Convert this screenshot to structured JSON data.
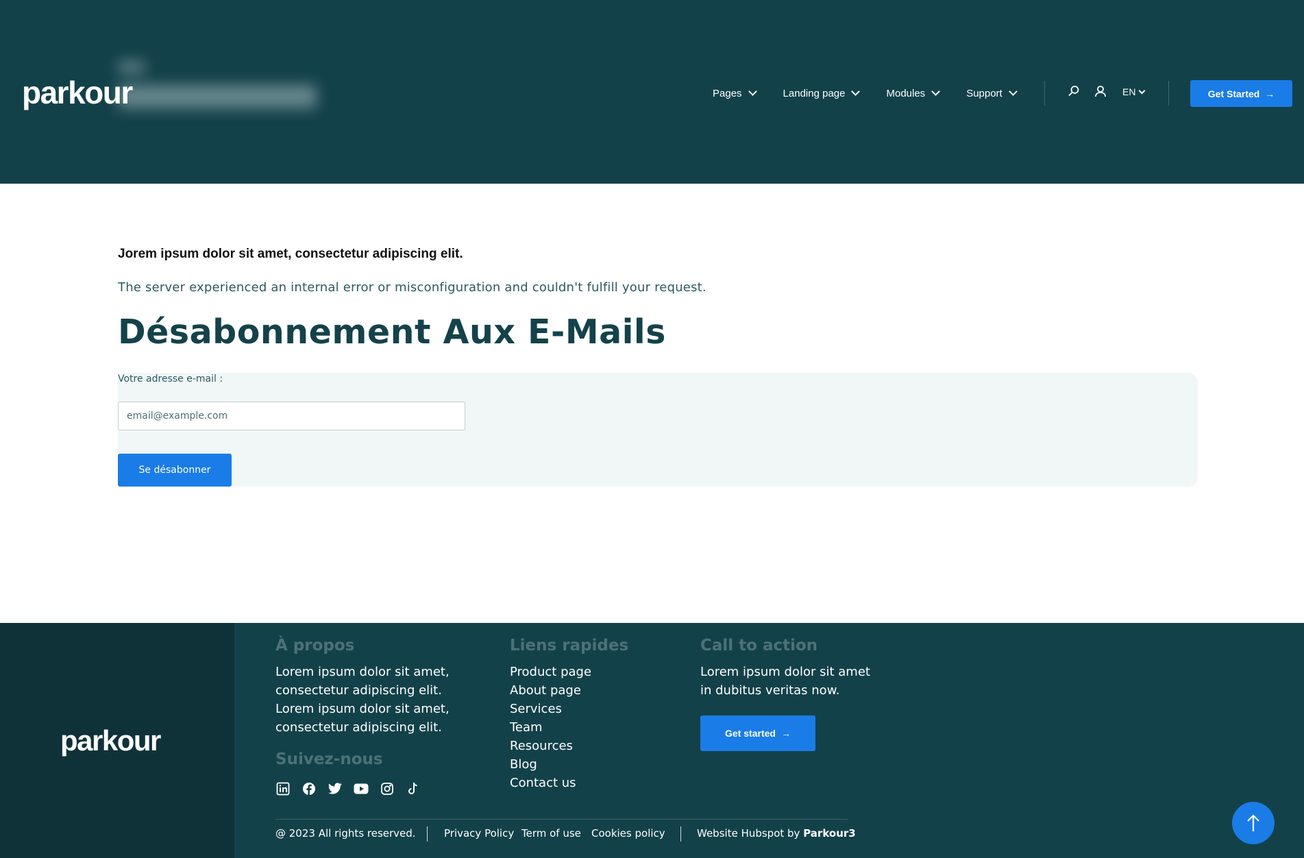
{
  "header": {
    "logo": "parkour",
    "nav": [
      {
        "label": "Pages"
      },
      {
        "label": "Landing page"
      },
      {
        "label": "Modules"
      },
      {
        "label": "Support"
      }
    ],
    "language": "EN",
    "cta_label": "Get Started",
    "cta_arrow": "→"
  },
  "main": {
    "lead": "Jorem ipsum dolor sit amet, consectetur adipiscing elit.",
    "description": "The server experienced an internal error or misconfiguration and couldn't fulfill your request.",
    "title": "Désabonnement Aux E-Mails",
    "form": {
      "label": "Votre adresse e-mail :",
      "placeholder": "email@example.com",
      "submit_label": "Se désabonner"
    }
  },
  "footer": {
    "logo": "parkour",
    "about": {
      "heading": "À propos",
      "lines": [
        "Lorem ipsum dolor sit amet,",
        "consectetur adipiscing elit.",
        "Lorem ipsum dolor sit amet,",
        "consectetur adipiscing elit."
      ]
    },
    "follow": {
      "heading": "Suivez-nous",
      "icons": [
        "linkedin-icon",
        "facebook-icon",
        "twitter-icon",
        "youtube-icon",
        "instagram-icon",
        "tiktok-icon"
      ]
    },
    "quick_links": {
      "heading": "Liens rapides",
      "items": [
        "Product page",
        "About page",
        "Services",
        "Team",
        "Resources",
        "Blog",
        "Contact us"
      ]
    },
    "cta": {
      "heading": "Call to action",
      "lines": [
        "Lorem ipsum dolor sit amet",
        "in dubitus veritas now."
      ],
      "button_label": "Get started",
      "button_arrow": "→"
    },
    "bottom": {
      "copyright": "@ 2023 All rights reserved.",
      "links": [
        "Privacy Policy",
        "Term of use",
        "Cookies policy"
      ],
      "credit_prefix": "Website Hubspot by ",
      "credit_name": "Parkour3"
    }
  },
  "colors": {
    "header_bg": "#13414a",
    "footer_dark": "#0f3239",
    "accent": "#1a7ce6",
    "title": "#15424a"
  }
}
